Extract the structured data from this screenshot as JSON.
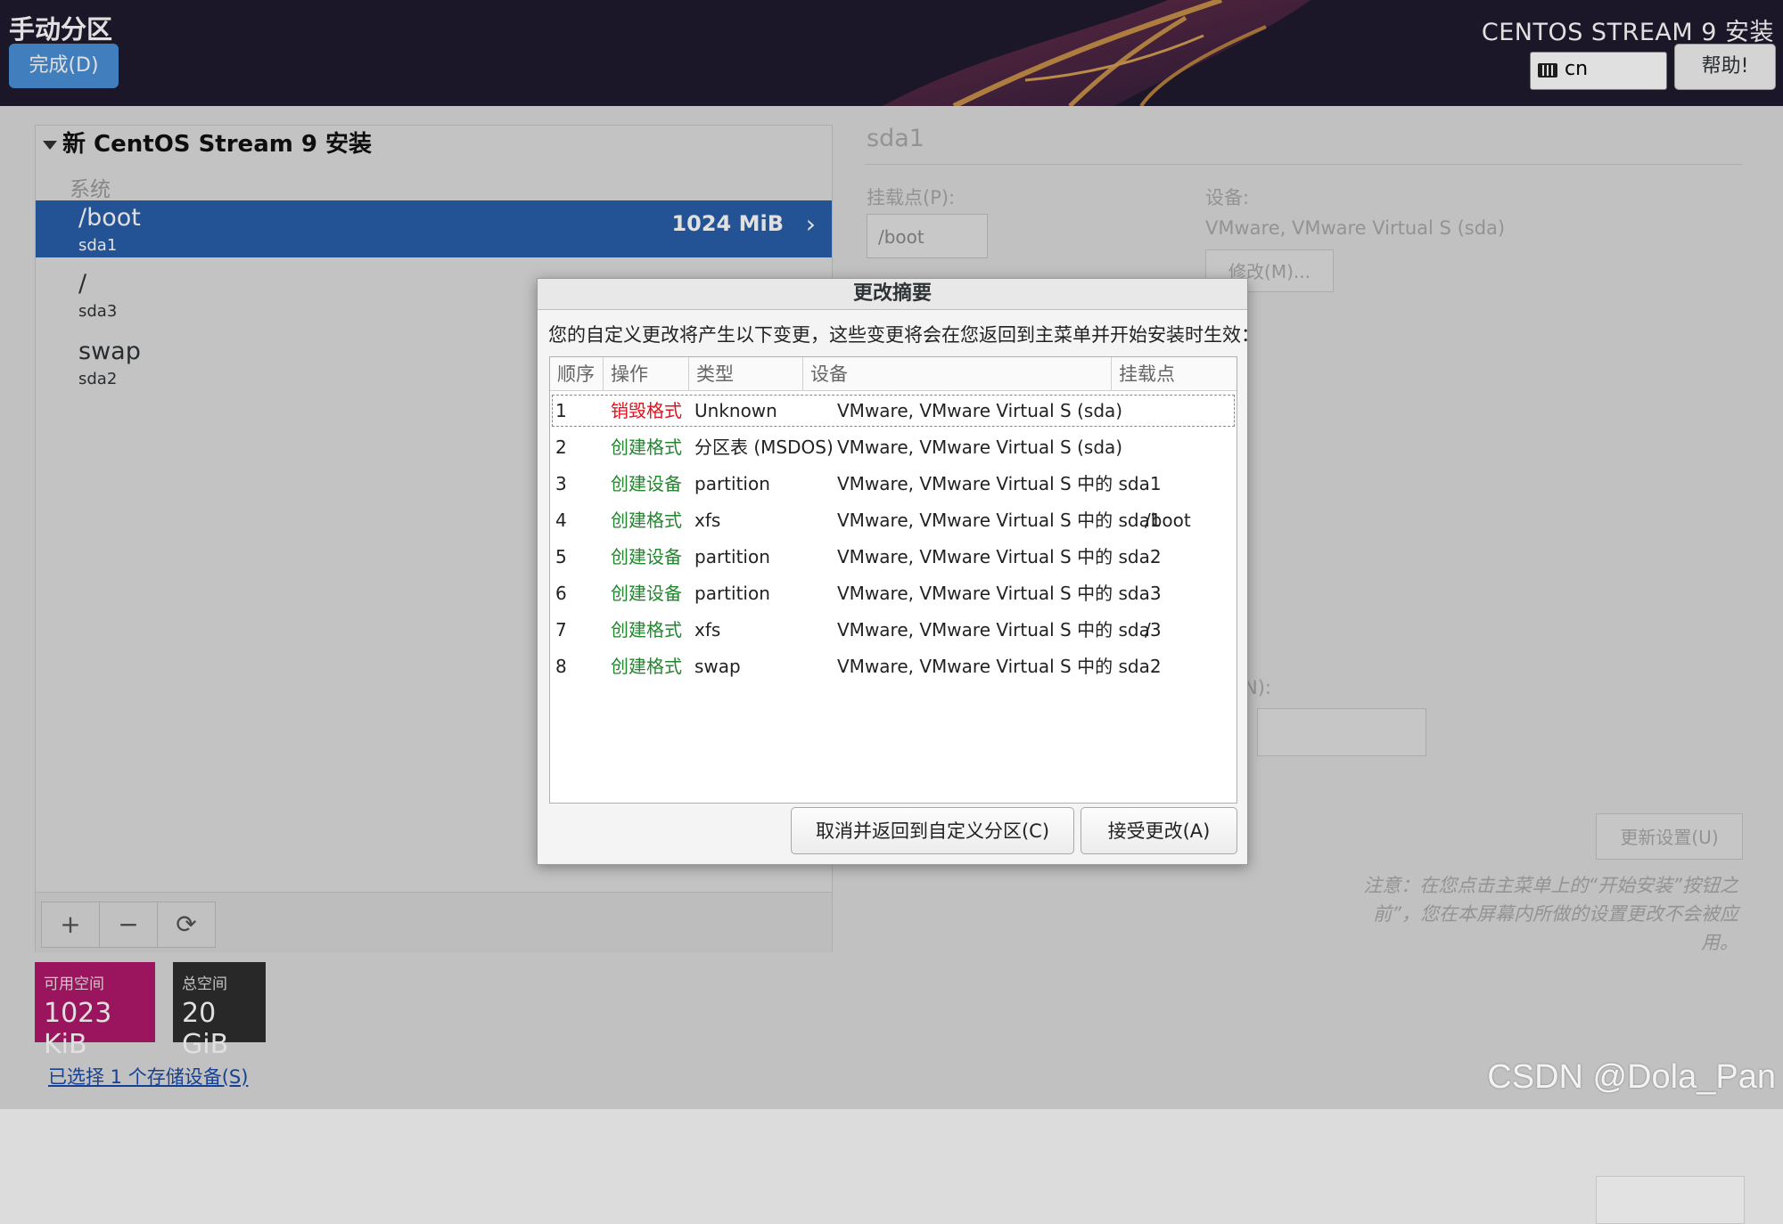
{
  "header": {
    "title": "手动分区",
    "done_label": "完成(D)",
    "product": "CENTOS STREAM 9 安装",
    "keyboard_layout": "cn",
    "help_label": "帮助!"
  },
  "left": {
    "install_title": "新 CentOS Stream 9 安装",
    "system_label": "系统",
    "partitions": [
      {
        "mount": "/boot",
        "device": "sda1",
        "size": "1024 MiB"
      },
      {
        "mount": "/",
        "device": "sda3"
      },
      {
        "mount": "swap",
        "device": "sda2"
      }
    ],
    "tools": {
      "add": "+",
      "remove": "−",
      "refresh": "⟳"
    },
    "available_label": "可用空间",
    "available_value": "1023 KiB",
    "total_label": "总空间",
    "total_value": "20 GiB",
    "storage_link": "已选择 1 个存储设备(S)"
  },
  "right": {
    "name": "sda1",
    "mount_label": "挂载点(P):",
    "mount_value": "/boot",
    "device_label": "设备:",
    "device_value": "VMware, VMware Virtual S (sda)",
    "modify_label": "修改(M)...",
    "fragment_label": "N):",
    "update_label": "更新设置(U)",
    "note": "注意：在您点击主菜单上的“开始安装”按钮之前”，您在本屏幕内所做的设置更改不会被应用。"
  },
  "dialog": {
    "title": "更改摘要",
    "message": "您的自定义更改将产生以下变更，这些变更将会在您返回到主菜单并开始安装时生效：",
    "columns": [
      "顺序",
      "操作",
      "类型",
      "设备",
      "挂载点"
    ],
    "rows": [
      {
        "order": "1",
        "action": "销毁格式",
        "type": "Unknown",
        "device": "VMware, VMware Virtual S (sda)",
        "mount": ""
      },
      {
        "order": "2",
        "action": "创建格式",
        "type": "分区表 (MSDOS)",
        "device": "VMware, VMware Virtual S (sda)",
        "mount": ""
      },
      {
        "order": "3",
        "action": "创建设备",
        "type": "partition",
        "device": "VMware, VMware Virtual S 中的 sda1",
        "mount": ""
      },
      {
        "order": "4",
        "action": "创建格式",
        "type": "xfs",
        "device": "VMware, VMware Virtual S 中的 sda1",
        "mount": "/boot"
      },
      {
        "order": "5",
        "action": "创建设备",
        "type": "partition",
        "device": "VMware, VMware Virtual S 中的 sda2",
        "mount": ""
      },
      {
        "order": "6",
        "action": "创建设备",
        "type": "partition",
        "device": "VMware, VMware Virtual S 中的 sda3",
        "mount": ""
      },
      {
        "order": "7",
        "action": "创建格式",
        "type": "xfs",
        "device": "VMware, VMware Virtual S 中的 sda3",
        "mount": "/"
      },
      {
        "order": "8",
        "action": "创建格式",
        "type": "swap",
        "device": "VMware, VMware Virtual S 中的 sda2",
        "mount": ""
      }
    ],
    "cancel_label": "取消并返回到自定义分区(C)",
    "accept_label": "接受更改(A)"
  },
  "colors": {
    "header_bg": "#1f1b2e",
    "accent_blue": "#4a90d9",
    "selection": "#2a5faa",
    "destroy_red": "#e0101e",
    "create_green": "#21862e",
    "available_bg": "#b0186a",
    "total_bg": "#2e2e2e"
  },
  "watermark": "CSDN @Dola_Pan"
}
